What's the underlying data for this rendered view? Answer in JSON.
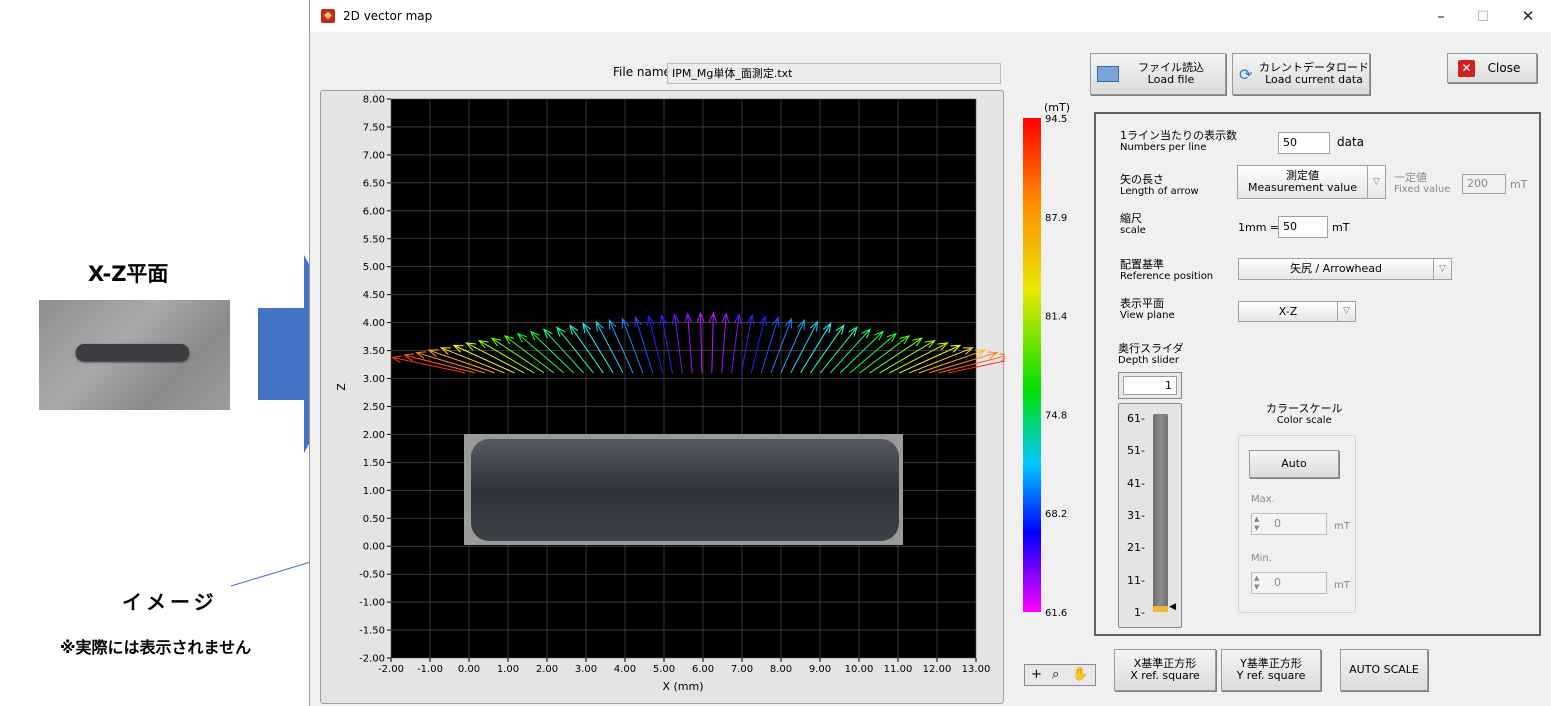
{
  "annotation": {
    "title": "X-Z平面",
    "image_label": "イメージ",
    "note": "※実際には表示されません"
  },
  "window": {
    "title": "2D vector map",
    "controls": {
      "minimize": "–",
      "maximize": "□",
      "close": "✕"
    }
  },
  "file": {
    "label": "File name",
    "value": "IPM_Mg単体_面測定.txt"
  },
  "graph": {
    "xlabel": "X (mm)",
    "ylabel": "Z",
    "xticks": [
      "-2.00",
      "-1.00",
      "0.00",
      "1.00",
      "2.00",
      "3.00",
      "4.00",
      "5.00",
      "6.00",
      "7.00",
      "8.00",
      "9.00",
      "10.00",
      "11.00",
      "12.00",
      "13.00"
    ],
    "yticks": [
      "8.00",
      "7.50",
      "7.00",
      "6.50",
      "6.00",
      "5.50",
      "5.00",
      "4.50",
      "4.00",
      "3.50",
      "3.00",
      "2.50",
      "2.00",
      "1.50",
      "1.00",
      "0.50",
      "0.00",
      "-0.50",
      "-1.00",
      "-1.50",
      "-2.00"
    ],
    "xlim": [
      -2,
      13
    ],
    "ylim": [
      -2,
      8
    ],
    "grid": true,
    "background": "#000000"
  },
  "colorbar": {
    "unit": "(mT)",
    "labels": [
      "94.5",
      "87.9",
      "81.4",
      "74.8",
      "68.2",
      "61.6"
    ]
  },
  "buttons": {
    "load_file": {
      "jp": "ファイル読込",
      "en": "Load file",
      "icon": "folder-icon"
    },
    "load_current": {
      "jp": "カレントデータロード",
      "en": "Load current data",
      "icon": "refresh-icon"
    },
    "close": {
      "label": "Close",
      "icon": "close-icon"
    },
    "x_square": {
      "jp": "X基準正方形",
      "en": "X ref. square"
    },
    "y_square": {
      "jp": "Y基準正方形",
      "en": "Y ref. square"
    },
    "auto_scale": "AUTO SCALE"
  },
  "settings": {
    "numbers_per_line": {
      "jp": "1ライン当たりの表示数",
      "en": "Numbers per line",
      "value": "50",
      "unit": "data"
    },
    "arrow_length": {
      "jp": "矢の長さ",
      "en": "Length of arrow",
      "selected_jp": "測定値",
      "selected_en": "Measurement value"
    },
    "fixed_value": {
      "jp": "一定値",
      "en": "Fixed value",
      "value": "200",
      "unit": "mT"
    },
    "scale": {
      "jp": "縮尺",
      "en": "scale",
      "prefix": "1mm =",
      "value": "50",
      "unit": "mT"
    },
    "reference": {
      "jp": "配置基準",
      "en": "Reference position",
      "selected": "矢尻 / Arrowhead"
    },
    "view_plane": {
      "jp": "表示平面",
      "en": "View plane",
      "selected": "X-Z"
    },
    "depth_slider": {
      "jp": "奥行スライダ",
      "en": "Depth slider",
      "value": "1",
      "ticks": [
        "61-",
        "51-",
        "41-",
        "31-",
        "21-",
        "11-",
        "1-"
      ],
      "max": 61,
      "position": 1
    },
    "color_scale": {
      "jp": "カラースケール",
      "en": "Color scale",
      "auto": "Auto",
      "max_label": "Max.",
      "max_value": "0",
      "min_label": "Min.",
      "min_value": "0",
      "unit": "mT"
    }
  },
  "arrow_field": {
    "count": 50,
    "x_start": -0.1,
    "x_end": 12.3,
    "base_z": 3.1
  },
  "colors": {
    "arrow_low": "#d000ff",
    "arrow_high": "#ff2000",
    "annotation_arrow": "#4472c4"
  }
}
